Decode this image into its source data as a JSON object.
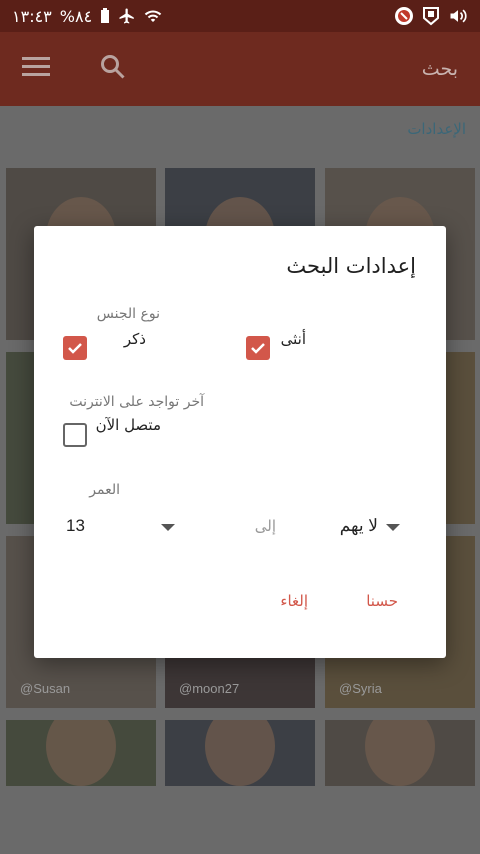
{
  "status_bar": {
    "time": "١٣:٤٣",
    "battery": "%٨٤",
    "icons": [
      "battery-icon",
      "airplane-icon",
      "wifi-icon",
      "app-notification-icon",
      "app-shield-icon",
      "volume-icon"
    ]
  },
  "appbar": {
    "title": "بحث",
    "icons": [
      "menu-icon",
      "search-icon"
    ]
  },
  "page": {
    "settings_link": "الإعدادات",
    "tiles": [
      {
        "handle": ""
      },
      {
        "handle": ""
      },
      {
        "handle": ""
      },
      {
        "handle": ""
      },
      {
        "handle": ""
      },
      {
        "handle": ""
      },
      {
        "handle": "@Susan"
      },
      {
        "handle": "@moon27"
      },
      {
        "handle": "@Syria"
      },
      {
        "handle": ""
      },
      {
        "handle": ""
      },
      {
        "handle": ""
      }
    ]
  },
  "dialog": {
    "title": "إعدادات البحث",
    "gender_section": "نوع الجنس",
    "female_label": "أنثى",
    "female_checked": true,
    "male_label": "ذكر",
    "male_checked": true,
    "online_section": "آخر تواجد على الانترنت",
    "online_label": "متصل الآن",
    "online_checked": false,
    "age_section": "العمر",
    "age_from": "لا يهم",
    "age_to_word": "إلى",
    "age_to": "13",
    "ok_button": "حسنا",
    "cancel_button": "إلغاء",
    "accent_color": "#d2574a"
  }
}
